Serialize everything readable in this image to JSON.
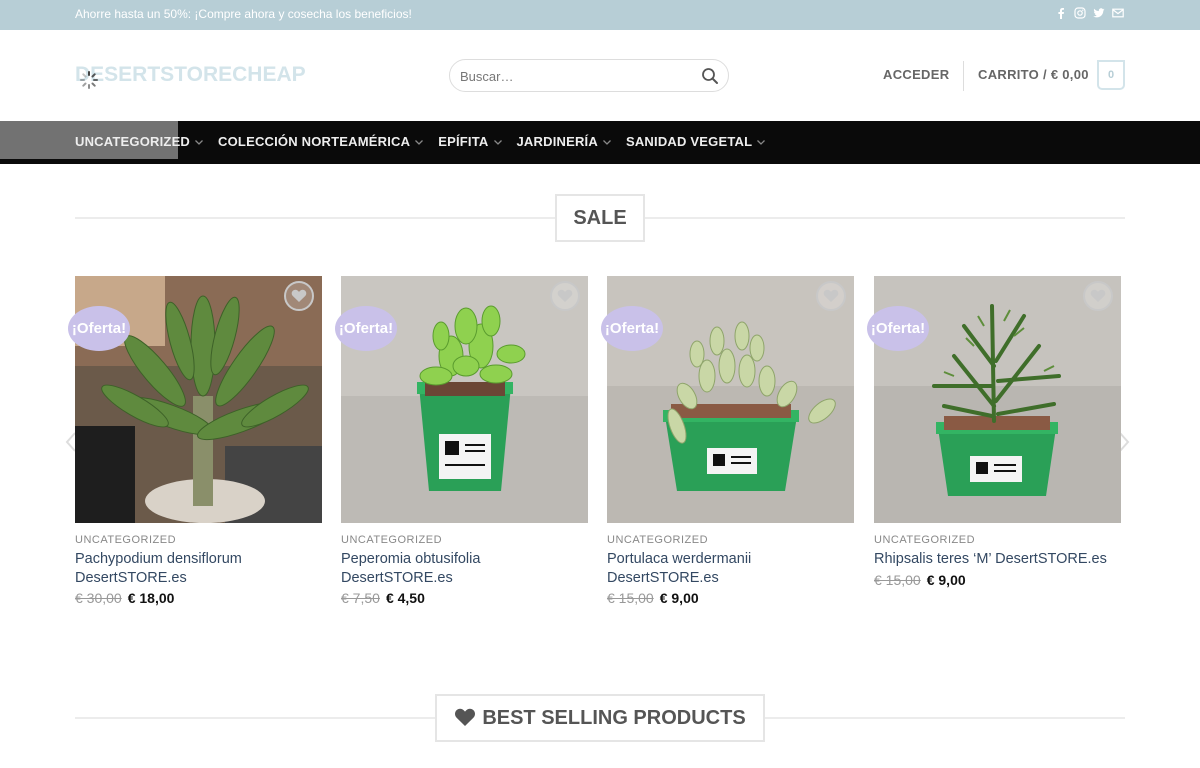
{
  "topbar": {
    "promo": "Ahorre hasta un 50%: ¡Compre ahora y cosecha los beneficios!",
    "icons": [
      "facebook-icon",
      "instagram-icon",
      "twitter-icon",
      "email-icon"
    ],
    "bg_color": "#b7ced6"
  },
  "header": {
    "logo": "DESERTSTORECHEAP",
    "search_placeholder": "Buscar…",
    "login": "ACCEDER",
    "cart_label": "CARRITO / € 0,00",
    "cart_count": "0"
  },
  "nav": {
    "items": [
      {
        "label": "UNCATEGORIZED"
      },
      {
        "label": "COLECCIÓN NORTEAMÉRICA"
      },
      {
        "label": "EPÍFITA"
      },
      {
        "label": "JARDINERÍA"
      },
      {
        "label": "SANIDAD VEGETAL"
      }
    ]
  },
  "sale_section": {
    "title": "SALE"
  },
  "products": [
    {
      "badge": "¡Oferta!",
      "category": "UNCATEGORIZED",
      "name": "Pachypodium densiflorum DesertSTORE.es",
      "old_price": "€ 30,00",
      "new_price": "€ 18,00"
    },
    {
      "badge": "¡Oferta!",
      "category": "UNCATEGORIZED",
      "name": "Peperomia obtusifolia DesertSTORE.es",
      "old_price": "€ 7,50",
      "new_price": "€ 4,50"
    },
    {
      "badge": "¡Oferta!",
      "category": "UNCATEGORIZED",
      "name": "Portulaca werdermanii DesertSTORE.es",
      "old_price": "€ 15,00",
      "new_price": "€ 9,00"
    },
    {
      "badge": "¡Oferta!",
      "category": "UNCATEGORIZED",
      "name": "Rhipsalis teres ‘M’ DesertSTORE.es",
      "old_price": "€ 15,00",
      "new_price": "€ 9,00"
    }
  ],
  "best_section": {
    "title": "BEST SELLING PRODUCTS"
  },
  "colors": {
    "badge": "#c9c1e9",
    "nav_bg": "#0a0a0a",
    "link": "#334862"
  }
}
